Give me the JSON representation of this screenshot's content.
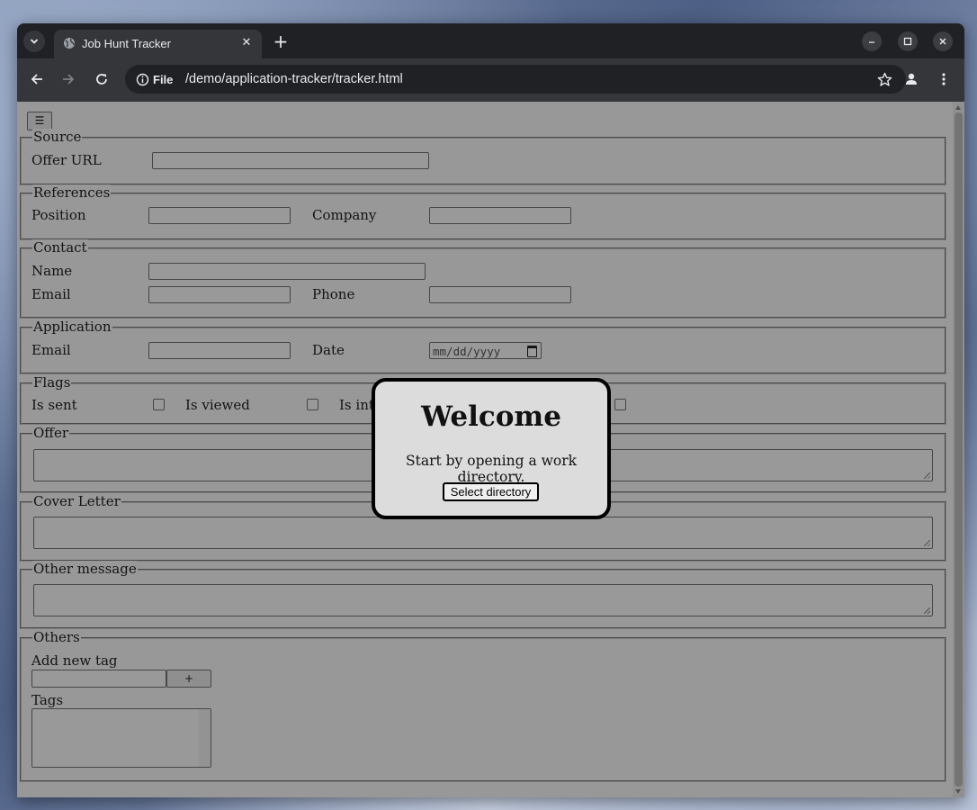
{
  "browser": {
    "tab_title": "Job Hunt Tracker",
    "site_info_label": "File",
    "url": "/demo/application-tracker/tracker.html"
  },
  "form": {
    "menu_icon": "☰",
    "source": {
      "legend": "Source",
      "offer_url_label": "Offer URL"
    },
    "references": {
      "legend": "References",
      "position_label": "Position",
      "company_label": "Company"
    },
    "contact": {
      "legend": "Contact",
      "name_label": "Name",
      "email_label": "Email",
      "phone_label": "Phone"
    },
    "application": {
      "legend": "Application",
      "email_label": "Email",
      "date_label": "Date",
      "date_placeholder": "mm/dd/yyyy"
    },
    "flags": {
      "legend": "Flags",
      "is_sent_label": "Is sent",
      "is_viewed_label": "Is viewed",
      "is_int_label": "Is int"
    },
    "offer": {
      "legend": "Offer"
    },
    "cover_letter": {
      "legend": "Cover Letter"
    },
    "other_message": {
      "legend": "Other message"
    },
    "others": {
      "legend": "Others",
      "add_tag_label": "Add new tag",
      "add_button": "+",
      "tags_label": "Tags"
    }
  },
  "modal": {
    "title": "Welcome",
    "text": "Start by opening a work directory.",
    "button": "Select directory"
  }
}
